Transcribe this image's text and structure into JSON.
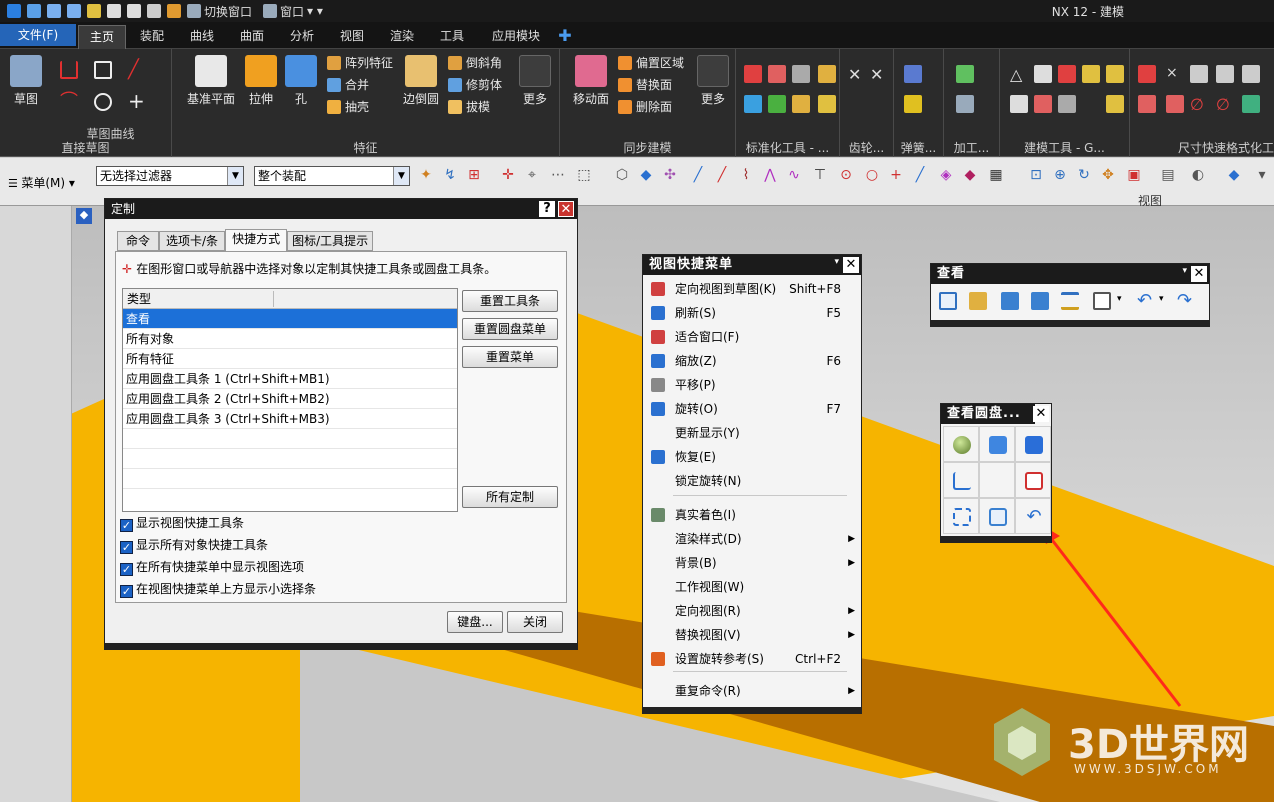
{
  "app": {
    "title": "NX 12 - 建模"
  },
  "quick_access": {
    "switch_window": "切换窗口",
    "window_menu": "窗口"
  },
  "tabs": [
    "文件(F)",
    "主页",
    "装配",
    "曲线",
    "曲面",
    "分析",
    "视图",
    "渲染",
    "工具",
    "应用模块"
  ],
  "ribbon": {
    "sketch_label": "草图",
    "sketch_curve_label": "草图曲线",
    "direct_sketch_label": "直接草图",
    "datum_plane": "基准平面",
    "extrude": "拉伸",
    "hole": "孔",
    "pattern_feature": "阵列特征",
    "unite": "合并",
    "shell": "抽壳",
    "edge_blend": "边倒圆",
    "chamfer": "倒斜角",
    "trim_body": "修剪体",
    "draft": "拔模",
    "more": "更多",
    "feature_label": "特征",
    "move_face": "移动面",
    "offset_region": "偏置区域",
    "replace_face": "替换面",
    "delete_face": "删除面",
    "more2": "更多",
    "sync_label": "同步建模",
    "std_tools_label": "标准化工具 - ...",
    "gear_label": "齿轮...",
    "spring_label": "弹簧...",
    "machining_label": "加工...",
    "build_tools_label": "建模工具 - G...",
    "dim_format_label": "尺寸快速格式化工"
  },
  "toolbar2": {
    "menu_label": "菜单(M)",
    "filter_value": "无选择过滤器",
    "assembly_value": "整个装配",
    "view_group_label": "视图"
  },
  "customize_dialog": {
    "title": "定制",
    "tabs": [
      "命令",
      "选项卡/条",
      "快捷方式",
      "图标/工具提示"
    ],
    "instruction": "在图形窗口或导航器中选择对象以定制其快捷工具条或圆盘工具条。",
    "column_header": "类型",
    "rows": [
      "查看",
      "所有对象",
      "所有特征",
      "应用圆盘工具条 1 (Ctrl+Shift+MB1)",
      "应用圆盘工具条 2 (Ctrl+Shift+MB2)",
      "应用圆盘工具条 3 (Ctrl+Shift+MB3)"
    ],
    "btn_reset_toolbar": "重置工具条",
    "btn_reset_radial": "重置圆盘菜单",
    "btn_reset_menu": "重置菜单",
    "btn_all_custom": "所有定制",
    "checks": [
      "显示视图快捷工具条",
      "显示所有对象快捷工具条",
      "在所有快捷菜单中显示视图选项",
      "在视图快捷菜单上方显示小选择条"
    ],
    "btn_keyboard": "键盘...",
    "btn_close": "关闭"
  },
  "view_popup": {
    "title": "视图快捷菜单",
    "items": [
      {
        "label": "定向视图到草图(K)",
        "shortcut": "Shift+F8",
        "icon": "orient-sketch-icon"
      },
      {
        "label": "刷新(S)",
        "shortcut": "F5",
        "icon": "refresh-icon"
      },
      {
        "label": "适合窗口(F)",
        "shortcut": "",
        "icon": "fit-icon"
      },
      {
        "label": "缩放(Z)",
        "shortcut": "F6",
        "icon": "zoom-icon"
      },
      {
        "label": "平移(P)",
        "shortcut": "",
        "icon": "pan-icon"
      },
      {
        "label": "旋转(O)",
        "shortcut": "F7",
        "icon": "rotate-icon"
      },
      {
        "label": "更新显示(Y)",
        "shortcut": "",
        "icon": ""
      },
      {
        "label": "恢复(E)",
        "shortcut": "",
        "icon": "restore-icon"
      },
      {
        "label": "锁定旋转(N)",
        "shortcut": "",
        "icon": ""
      },
      {
        "label": "真实着色(I)",
        "shortcut": "",
        "icon": "true-shading-icon"
      },
      {
        "label": "渲染样式(D)",
        "shortcut": "",
        "icon": "",
        "submenu": true
      },
      {
        "label": "背景(B)",
        "shortcut": "",
        "icon": "",
        "submenu": true
      },
      {
        "label": "工作视图(W)",
        "shortcut": "",
        "icon": ""
      },
      {
        "label": "定向视图(R)",
        "shortcut": "",
        "icon": "",
        "submenu": true
      },
      {
        "label": "替换视图(V)",
        "shortcut": "",
        "icon": "",
        "submenu": true
      },
      {
        "label": "设置旋转参考(S)",
        "shortcut": "Ctrl+F2",
        "icon": "rotate-ref-icon"
      },
      {
        "label": "重复命令(R)",
        "shortcut": "",
        "icon": "",
        "submenu": true
      }
    ]
  },
  "view_toolbar": {
    "title": "查看"
  },
  "radial_toolbar": {
    "title": "查看圆盘..."
  },
  "watermark": {
    "brand": "3D世界网",
    "url": "WWW.3DSJW.COM"
  },
  "colors": {
    "accent": "#1c70d8",
    "part_top": "#f6b400",
    "part_side": "#b86f00",
    "arrow": "#ff2a1a"
  }
}
